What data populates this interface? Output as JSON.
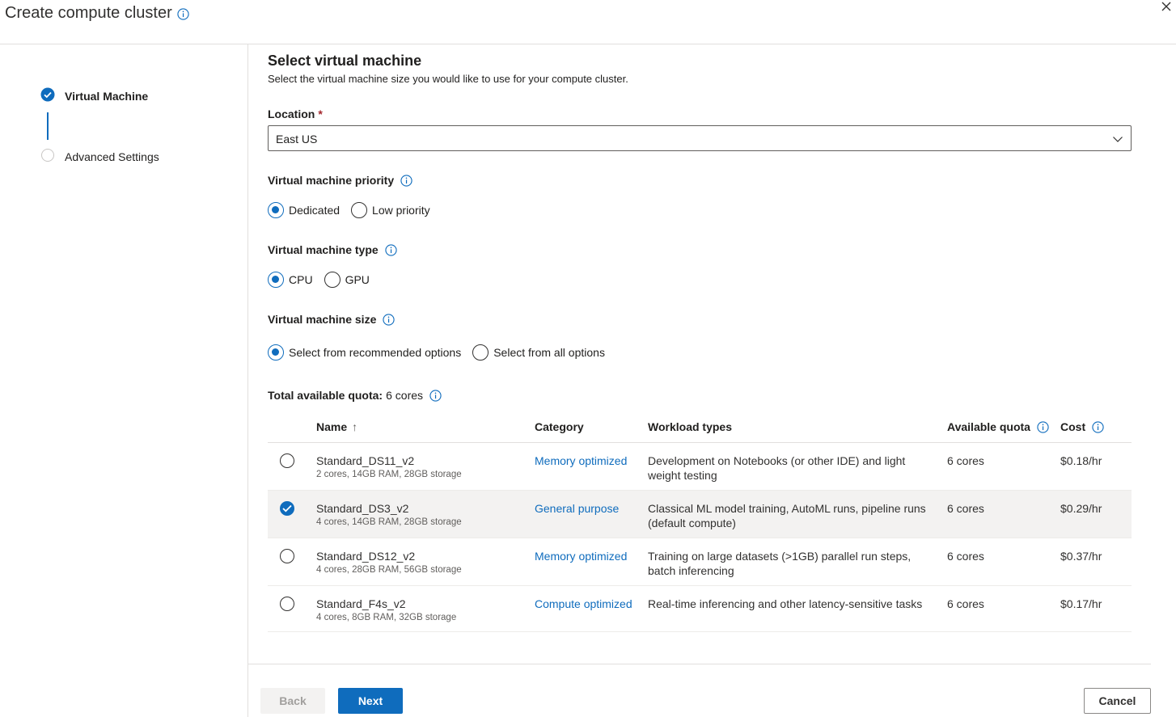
{
  "header": {
    "title": "Create compute cluster"
  },
  "steps": [
    {
      "label": "Virtual Machine",
      "state": "complete"
    },
    {
      "label": "Advanced Settings",
      "state": "pending"
    }
  ],
  "section": {
    "title": "Select virtual machine",
    "subtitle": "Select the virtual machine size you would like to use for your compute cluster."
  },
  "location": {
    "label": "Location",
    "required_mark": "*",
    "value": "East US"
  },
  "priority": {
    "label": "Virtual machine priority",
    "options": [
      "Dedicated",
      "Low priority"
    ],
    "selected": "Dedicated"
  },
  "vm_type": {
    "label": "Virtual machine type",
    "options": [
      "CPU",
      "GPU"
    ],
    "selected": "CPU"
  },
  "vm_size": {
    "label": "Virtual machine size",
    "options": [
      "Select from recommended options",
      "Select from all options"
    ],
    "selected": "Select from recommended options"
  },
  "quota": {
    "label": "Total available quota:",
    "value": "6 cores"
  },
  "table": {
    "columns": {
      "name": "Name",
      "sort_indicator": "↑",
      "category": "Category",
      "workload": "Workload types",
      "quota": "Available quota",
      "cost": "Cost"
    },
    "rows": [
      {
        "name": "Standard_DS11_v2",
        "details": "2 cores, 14GB RAM, 28GB storage",
        "category": "Memory optimized",
        "workload": "Development on Notebooks (or other IDE) and light weight testing",
        "quota": "6 cores",
        "cost": "$0.18/hr",
        "selected": false
      },
      {
        "name": "Standard_DS3_v2",
        "details": "4 cores, 14GB RAM, 28GB storage",
        "category": "General purpose",
        "workload": "Classical ML model training, AutoML runs, pipeline runs (default compute)",
        "quota": "6 cores",
        "cost": "$0.29/hr",
        "selected": true
      },
      {
        "name": "Standard_DS12_v2",
        "details": "4 cores, 28GB RAM, 56GB storage",
        "category": "Memory optimized",
        "workload": "Training on large datasets (>1GB) parallel run steps, batch inferencing",
        "quota": "6 cores",
        "cost": "$0.37/hr",
        "selected": false
      },
      {
        "name": "Standard_F4s_v2",
        "details": "4 cores, 8GB RAM, 32GB storage",
        "category": "Compute optimized",
        "workload": "Real-time inferencing and other latency-sensitive tasks",
        "quota": "6 cores",
        "cost": "$0.17/hr",
        "selected": false
      }
    ]
  },
  "footer": {
    "back": "Back",
    "next": "Next",
    "cancel": "Cancel"
  },
  "colors": {
    "accent": "#0f6cbd",
    "required": "#a4262c",
    "border": "#e1dfdd",
    "selected_row": "#f3f2f1"
  },
  "icons": [
    "info-icon",
    "close-icon",
    "chevron-down-icon",
    "check-icon",
    "sort-arrow-icon"
  ]
}
